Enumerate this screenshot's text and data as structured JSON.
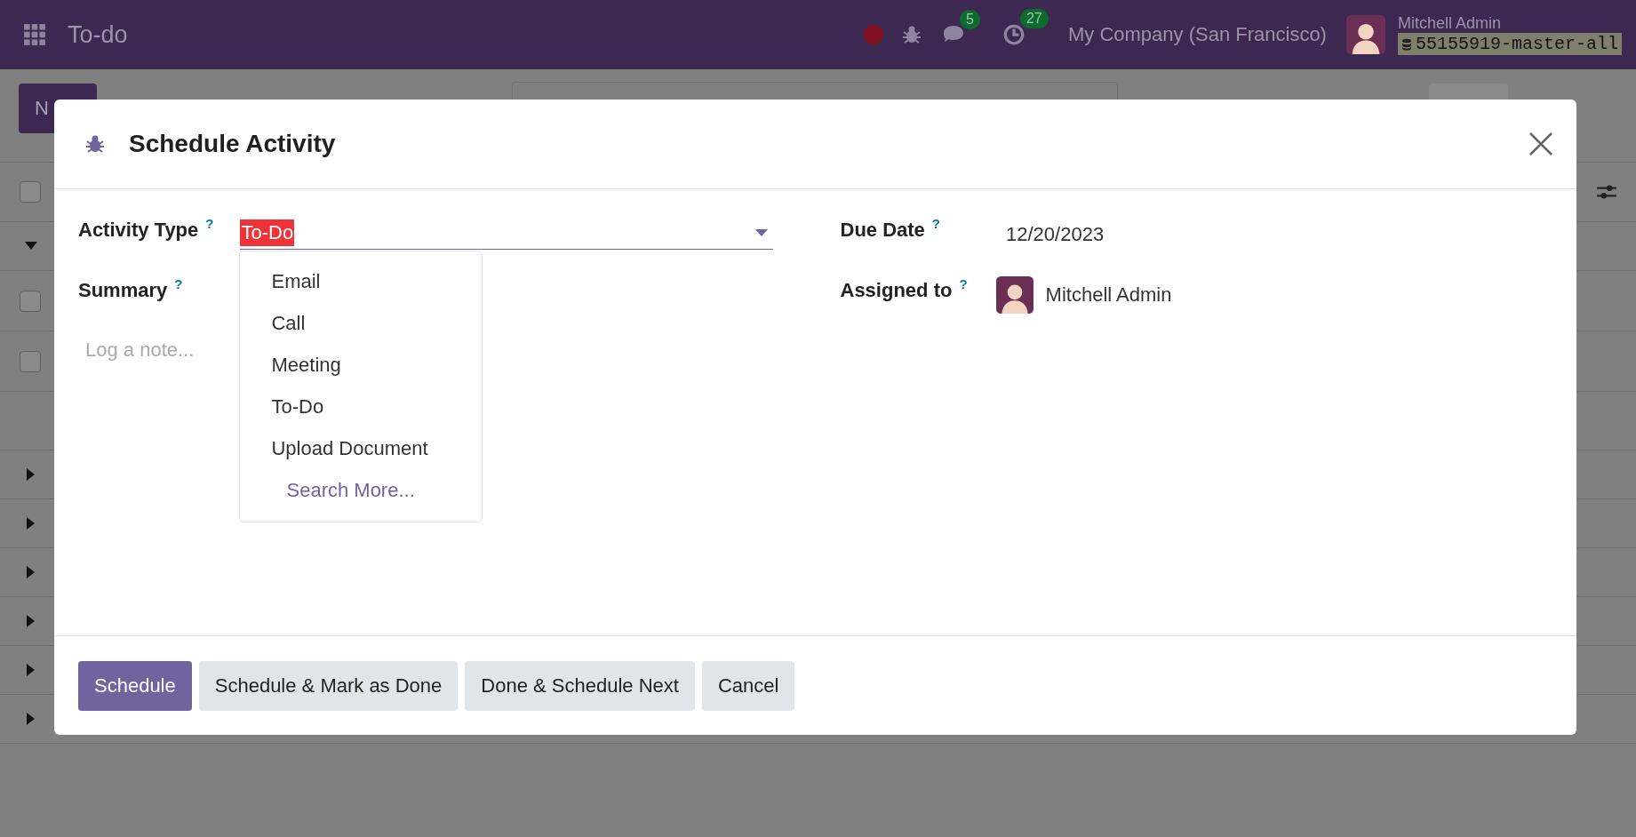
{
  "navbar": {
    "app_title": "To-do",
    "recording": true,
    "messages_count": "5",
    "activities_count": "27",
    "company": "My Company (San Francisco)",
    "user_name": "Mitchell Admin",
    "database": "55155919-master-all"
  },
  "background": {
    "new_button": "N",
    "rows": [
      {
        "kind": "header",
        "checked": false
      },
      {
        "kind": "group",
        "expanded": true
      },
      {
        "kind": "record",
        "checked": false
      },
      {
        "kind": "record",
        "checked": false
      },
      {
        "kind": "blank"
      },
      {
        "kind": "group",
        "expanded": false
      },
      {
        "kind": "group",
        "expanded": false
      },
      {
        "kind": "group",
        "expanded": false
      },
      {
        "kind": "group",
        "expanded": false
      },
      {
        "kind": "group",
        "expanded": false
      },
      {
        "kind": "group",
        "expanded": false
      }
    ]
  },
  "dialog": {
    "title": "Schedule Activity",
    "left_fields": [
      {
        "label": "Activity Type",
        "help": "?",
        "kind": "select",
        "value": "To-Do",
        "highlighted": true
      },
      {
        "label": "Summary",
        "help": "?",
        "kind": "text"
      }
    ],
    "right_fields": [
      {
        "label": "Due Date",
        "help": "?",
        "kind": "text",
        "value": "12/20/2023"
      },
      {
        "label": "Assigned to",
        "help": "?",
        "kind": "user",
        "value": "Mitchell Admin"
      }
    ],
    "note_placeholder": "Log a note...",
    "dropdown": {
      "options": [
        "Email",
        "Call",
        "Meeting",
        "To-Do",
        "Upload Document"
      ],
      "search_more": "Search More..."
    },
    "buttons": [
      {
        "label": "Schedule",
        "primary": true
      },
      {
        "label": "Schedule & Mark as Done",
        "primary": false
      },
      {
        "label": "Done & Schedule Next",
        "primary": false
      },
      {
        "label": "Cancel",
        "primary": false
      }
    ]
  }
}
